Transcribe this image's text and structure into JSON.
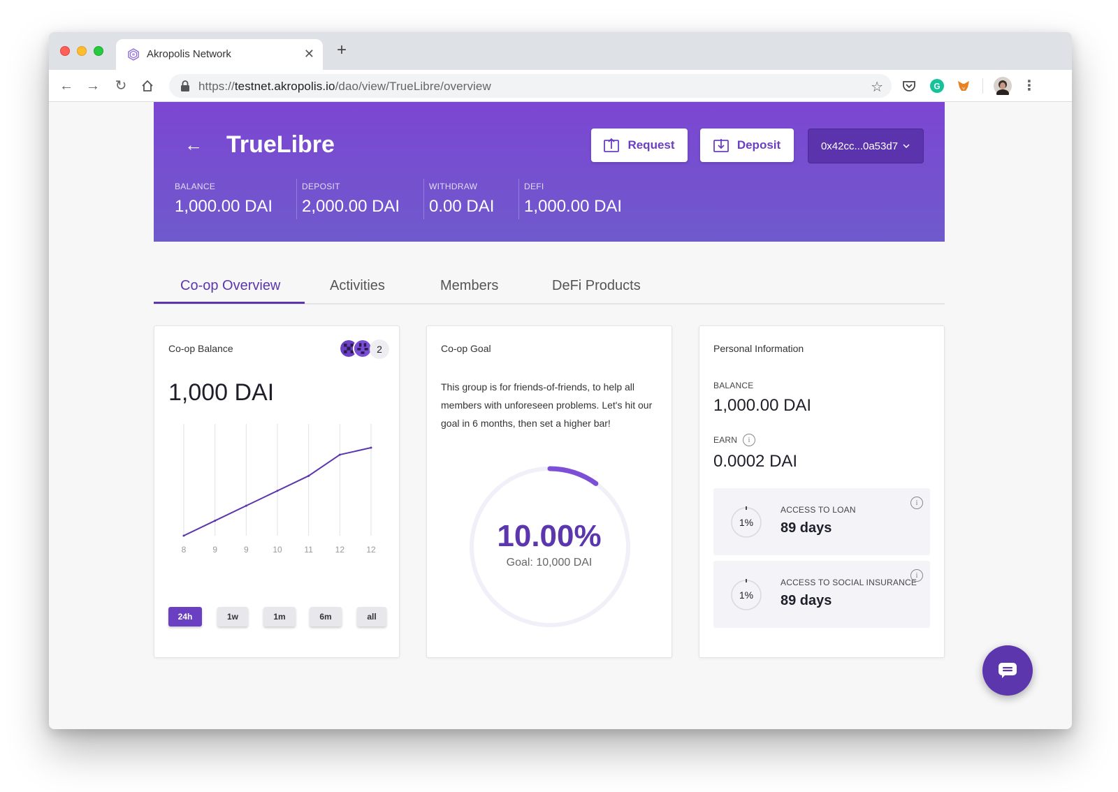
{
  "browser": {
    "tab_title": "Akropolis Network",
    "url_prefix": "https://",
    "url_host": "testnet.akropolis.io",
    "url_path": "/dao/view/TrueLibre/overview"
  },
  "hero": {
    "title": "TrueLibre",
    "request_label": "Request",
    "deposit_label": "Deposit",
    "account": "0x42cc...0a53d7",
    "stats": [
      {
        "label": "BALANCE",
        "value": "1,000.00 DAI"
      },
      {
        "label": "DEPOSIT",
        "value": "2,000.00 DAI"
      },
      {
        "label": "WITHDRAW",
        "value": "0.00 DAI"
      },
      {
        "label": "DEFI",
        "value": "1,000.00 DAI"
      }
    ]
  },
  "tabs": [
    {
      "label": "Co-op Overview",
      "active": true
    },
    {
      "label": "Activities",
      "active": false
    },
    {
      "label": "Members",
      "active": false
    },
    {
      "label": "DeFi Products",
      "active": false
    }
  ],
  "coop_balance": {
    "title": "Co-op Balance",
    "member_count": "2",
    "value": "1,000 DAI",
    "periods": [
      "24h",
      "1w",
      "1m",
      "6m",
      "all"
    ],
    "active_period": "24h"
  },
  "chart_data": {
    "type": "line",
    "categories": [
      "8",
      "9",
      "9",
      "10",
      "11",
      "12",
      "12"
    ],
    "values": [
      0,
      170,
      340,
      510,
      680,
      920,
      1000
    ],
    "title": "",
    "xlabel": "",
    "ylabel": "",
    "grid": "vertical",
    "color": "#5b36ad"
  },
  "coop_goal": {
    "title": "Co-op Goal",
    "description": "This group is for friends-of-friends, to help all members with unforeseen problems. Let's hit our goal in 6 months, then set a higher bar!",
    "percent": "10.00%",
    "progress": 0.1,
    "goal": "Goal: 10,000 DAI"
  },
  "personal": {
    "title": "Personal Information",
    "balance_label": "BALANCE",
    "balance_value": "1,000.00 DAI",
    "earn_label": "EARN",
    "earn_value": "0.0002 DAI",
    "access": [
      {
        "label": "ACCESS TO LOAN",
        "value": "89 days",
        "percent": "1%"
      },
      {
        "label": "ACCESS TO SOCIAL INSURANCE",
        "value": "89 days",
        "percent": "1%"
      }
    ]
  },
  "colors": {
    "brand": "#6a3fc2",
    "accent": "#5b36ad"
  }
}
